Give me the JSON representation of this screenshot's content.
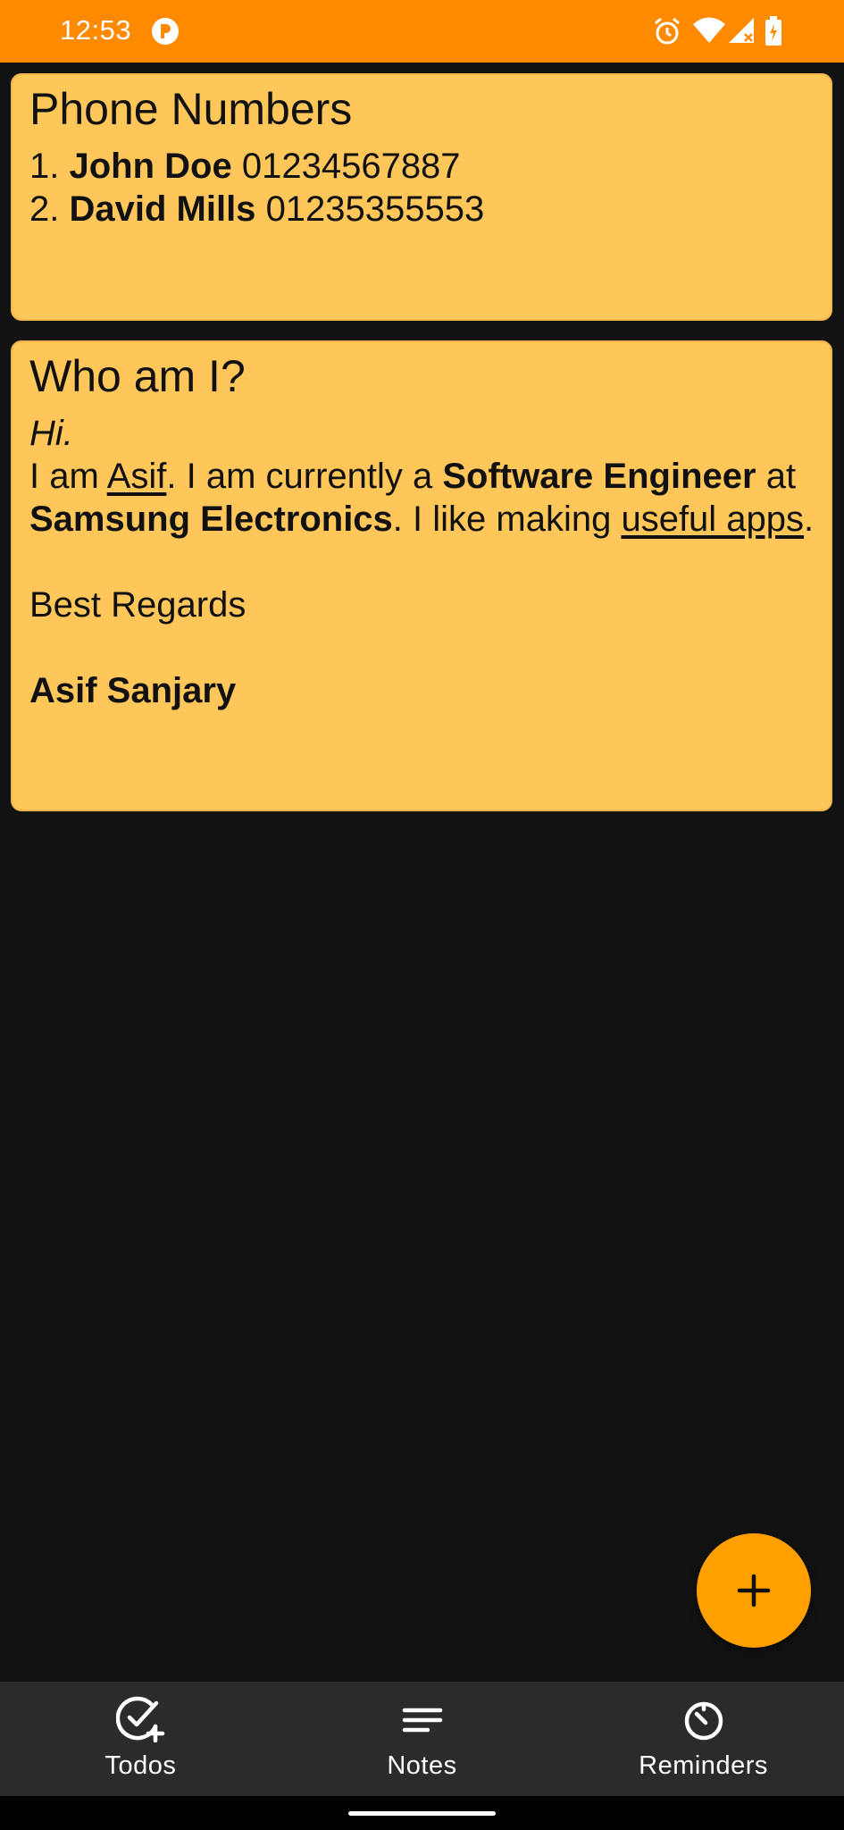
{
  "status_bar": {
    "time": "12:53",
    "background": "#FF8A00",
    "icons": [
      "app-notification-icon",
      "alarm-icon",
      "wifi-icon",
      "cell-signal-icon",
      "battery-charging-icon"
    ]
  },
  "notes": [
    {
      "title": "Phone Numbers",
      "entries": [
        {
          "number": "1.",
          "name": "John Doe",
          "phone": "01234567887"
        },
        {
          "number": "2.",
          "name": "David Mills",
          "phone": "01235355553"
        }
      ]
    },
    {
      "title": "Who am I?",
      "greeting": "Hi.",
      "body": {
        "t1": "I am ",
        "name_link": "Asif",
        "t2": ". I am currently a ",
        "role": "Software Engineer",
        "t3": " at",
        "company": "Samsung Electronics",
        "t4": ". I like making ",
        "apps_link": "useful apps",
        "t5": "."
      },
      "closing": "Best Regards",
      "signature": "Asif Sanjary"
    }
  ],
  "fab": {
    "icon": "plus-icon",
    "color": "#FFA000"
  },
  "bottom_nav": [
    {
      "label": "Todos",
      "icon": "todo-check-add-icon"
    },
    {
      "label": "Notes",
      "icon": "notes-lines-icon"
    },
    {
      "label": "Reminders",
      "icon": "reminder-timer-icon"
    }
  ],
  "colors": {
    "note_background": "#FFC65A",
    "app_background": "#121212",
    "nav_background": "#2B2B2B"
  }
}
